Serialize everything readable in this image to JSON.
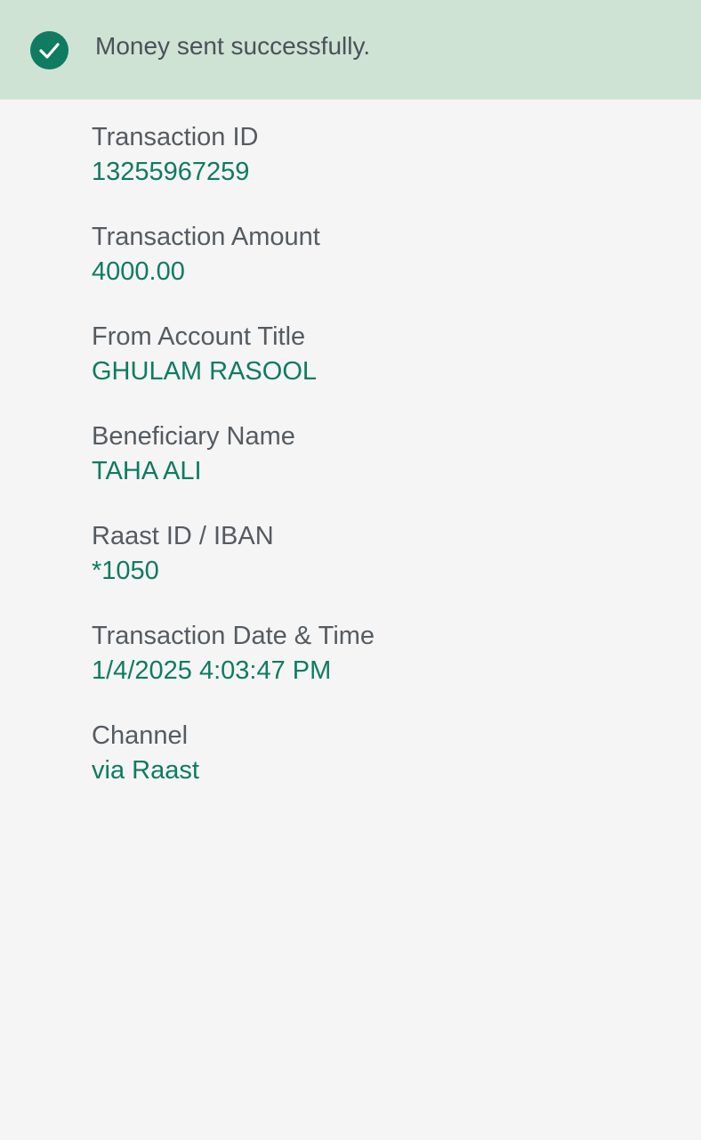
{
  "banner": {
    "message": "Money sent successfully.",
    "icon": "check-circle-icon",
    "icon_color": "#0f7b61",
    "background_color": "#cfe3d4"
  },
  "details": {
    "accent_color": "#0f7b61",
    "fields": [
      {
        "label": "Transaction ID",
        "value": "13255967259"
      },
      {
        "label": "Transaction Amount",
        "value": "4000.00"
      },
      {
        "label": "From Account Title",
        "value": "GHULAM RASOOL"
      },
      {
        "label": "Beneficiary Name",
        "value": "TAHA ALI"
      },
      {
        "label": "Raast ID / IBAN",
        "value": "*1050"
      },
      {
        "label": "Transaction Date & Time",
        "value": "1/4/2025 4:03:47 PM"
      },
      {
        "label": "Channel",
        "value": "via Raast"
      }
    ]
  }
}
